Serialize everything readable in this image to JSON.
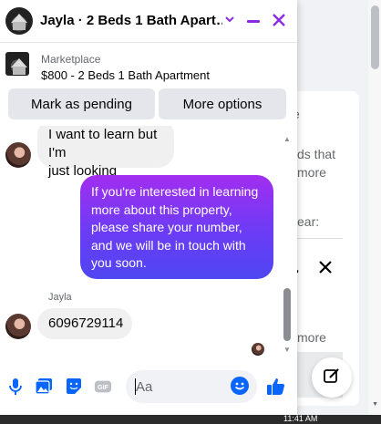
{
  "chat": {
    "title": "Jayla · 2 Beds 1 Bath Apart…",
    "listing_label": "Marketplace",
    "listing_name": "$800 - 2 Beds 1 Bath Apartment",
    "mark_pending_label": "Mark as pending",
    "more_options_label": "More options",
    "messages": {
      "incoming_partial_1": "I want to learn but I'm",
      "incoming_partial_2": "just looking",
      "outgoing": "If you're interested in learning more about this property, please share your number, and we will be in touch with you soon.",
      "sender_name": "Jayla",
      "incoming_number": "6096729114"
    },
    "input_placeholder": "Aa"
  },
  "background": {
    "fragment_1": "e",
    "fragment_2": "ds that",
    "fragment_3": "more",
    "fragment_4": "ear:",
    "fragment_5": "more"
  },
  "taskbar": {
    "clock": "11:41 AM"
  },
  "colors": {
    "accent": "#8a2be2",
    "messenger_blue": "#0866ff",
    "gradient_top": "#a22ef0",
    "gradient_bottom": "#4f46f2"
  },
  "icons": [
    "chevron-down-icon",
    "minimize-icon",
    "close-icon",
    "microphone-icon",
    "photo-icon",
    "sticker-icon",
    "gif-icon",
    "emoji-icon",
    "thumbs-up-icon",
    "compose-icon"
  ]
}
